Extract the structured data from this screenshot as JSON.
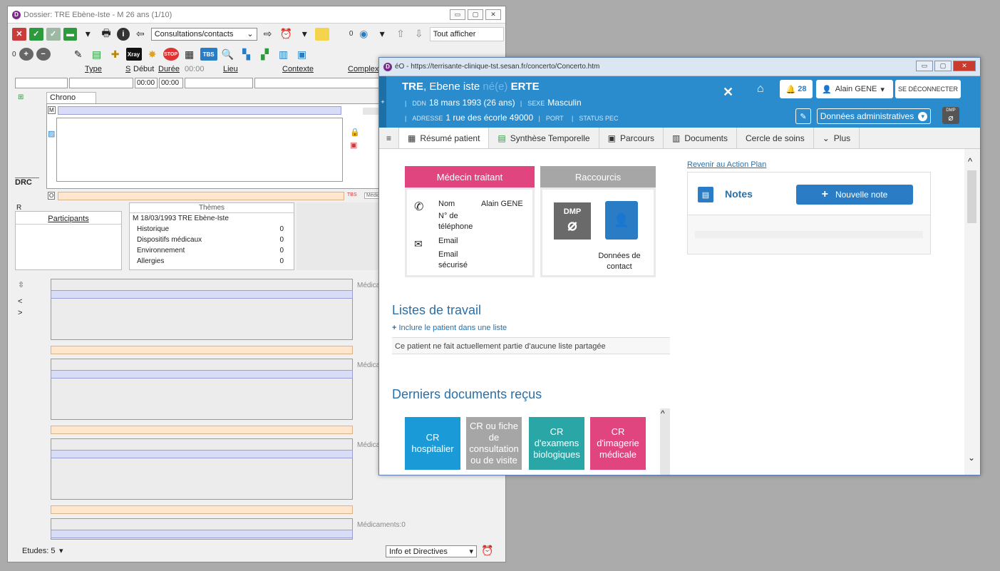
{
  "back_window": {
    "title": "Dossier: TRE Ebène-Iste - M 26 ans (1/10)",
    "toolbar": {
      "consult_select": "Consultations/contacts",
      "counter_a": "0",
      "counter_b": "0",
      "filter_label": "Tout afficher",
      "xray_label": "Xray",
      "stop_label": "STOP",
      "tbs_label": "TBS"
    },
    "columns": {
      "type": "Type",
      "s": "S",
      "debut": "Début",
      "duree": "Durée",
      "duree_value": "00:00",
      "lieu": "Lieu",
      "contexte": "Contexte",
      "complexe": "Complexe"
    },
    "fields": {
      "time1": "00:00",
      "time2": "00:00"
    },
    "chrono_tab": "Chrono",
    "box_m": "M",
    "box_o": "O",
    "drc": "DRC",
    "tbs_small": "TBS",
    "medic_small": "Médicam",
    "r_label": "R",
    "participants": "Participants",
    "themes": {
      "title": "Thèmes",
      "root": "M 18/03/1993 TRE Ebène-Iste",
      "items": [
        {
          "label": "Historique",
          "count": "0"
        },
        {
          "label": "Dispositifs médicaux",
          "count": "0"
        },
        {
          "label": "Environnement",
          "count": "0"
        },
        {
          "label": "Allergies",
          "count": "0"
        }
      ]
    },
    "lower": {
      "med_short": "Médicam",
      "med_full": "Médicaments:0",
      "chev_lt": "<",
      "chev_gt": ">"
    },
    "bottom": {
      "etudes": "Etudes: 5",
      "info_select": "Info et Directives"
    }
  },
  "front_window": {
    "url": "éO - https://terrisante-clinique-tst.sesan.fr/concerto/Concerto.htm",
    "patient": {
      "lastname": "TRE",
      "firstname": ", Ebene iste",
      "nee_label": " né(e) ",
      "birthname": "ERTE",
      "ddn_label": "DDN",
      "ddn": "18 mars 1993 (26 ans)",
      "sexe_label": "SEXE",
      "sexe": "Masculin",
      "adresse_label": "ADRESSE",
      "adresse": "1 rue des écorle 49000",
      "port_label": "PORT",
      "status_label": "STATUS PEC"
    },
    "header": {
      "notif_count": "28",
      "user": "Alain GENE",
      "logout": "SE DÉCONNECTER",
      "admin_button": "Données administratives",
      "dmp_label": "DMP"
    },
    "nav": [
      {
        "label": "Résumé patient"
      },
      {
        "label": "Synthèse Temporelle"
      },
      {
        "label": "Parcours"
      },
      {
        "label": "Documents"
      },
      {
        "label": "Cercle de soins"
      },
      {
        "label": "Plus"
      }
    ],
    "medecin_card": {
      "title": "Médecin traitant",
      "nom_label": "Nom",
      "nom_value": "Alain GENE",
      "tel_label": "N° de téléphone",
      "email_label": "Email",
      "email_secure_label": "Email sécurisé"
    },
    "raccourcis_card": {
      "title": "Raccourcis",
      "dmp_label": "DMP",
      "contact_label": "Données de contact"
    },
    "action_plan_link": "Revenir au Action Plan",
    "notes": {
      "title": "Notes",
      "new_button": "Nouvelle note"
    },
    "listes": {
      "title": "Listes de travail",
      "include_link": "Inclure le patient dans une liste",
      "message": "Ce patient ne fait actuellement partie d'aucune liste partagée"
    },
    "documents": {
      "title": "Derniers documents reçus",
      "tiles": [
        {
          "label": "CR hospitalier",
          "color": "#1a9ad6"
        },
        {
          "label": "CR ou fiche de consultation ou de visite",
          "color": "#a6a6a6"
        },
        {
          "label": "CR d'examens biologiques",
          "color": "#2aa6a6"
        },
        {
          "label": "CR d'imagerie médicale",
          "color": "#e0457f"
        }
      ]
    }
  }
}
